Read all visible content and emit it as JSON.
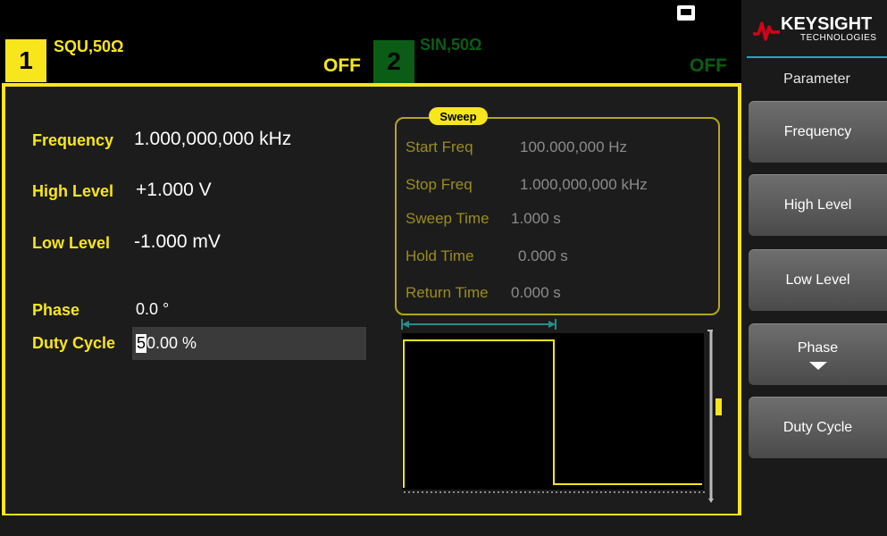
{
  "channel1": {
    "number": "1",
    "function": "SQU,50Ω",
    "state": "OFF"
  },
  "channel2": {
    "number": "2",
    "function": "SIN,50Ω",
    "state": "OFF"
  },
  "parameters": {
    "frequency": {
      "label": "Frequency",
      "value": "1.000,000,000 kHz"
    },
    "high_level": {
      "label": "High Level",
      "value": "+1.000 V"
    },
    "low_level": {
      "label": "Low Level",
      "value": "-1.000 mV"
    },
    "phase": {
      "label": "Phase",
      "value": "0.0 °"
    },
    "duty_cycle": {
      "label": "Duty Cycle",
      "cursor_char": "5",
      "value_rest": "0.00 %"
    }
  },
  "sweep": {
    "title": "Sweep",
    "start_freq": {
      "label": "Start Freq",
      "value": "100.000,000 Hz"
    },
    "stop_freq": {
      "label": "Stop Freq",
      "value": "1.000,000,000 kHz"
    },
    "sweep_time": {
      "label": "Sweep Time",
      "value": "1.000 s"
    },
    "hold_time": {
      "label": "Hold Time",
      "value": "0.000 s"
    },
    "return_time": {
      "label": "Return Time",
      "value": "0.000 s"
    }
  },
  "brand": {
    "name": "KEYSIGHT",
    "sub": "TECHNOLOGIES"
  },
  "softkeys": {
    "title": "Parameter",
    "items": [
      {
        "label": "Frequency"
      },
      {
        "label": "High Level"
      },
      {
        "label": "Low Level"
      },
      {
        "label": "Phase"
      },
      {
        "label": "Duty Cycle"
      }
    ]
  },
  "colors": {
    "ch1_accent": "#f7e61c",
    "ch2_accent": "#0b5d16",
    "brand_red": "#d4001a",
    "separator": "#2aa4bf"
  },
  "icons": {
    "lan": "lan-status-icon",
    "brand_logo": "keysight-wave-logo",
    "phase_more": "down-arrow-icon"
  }
}
